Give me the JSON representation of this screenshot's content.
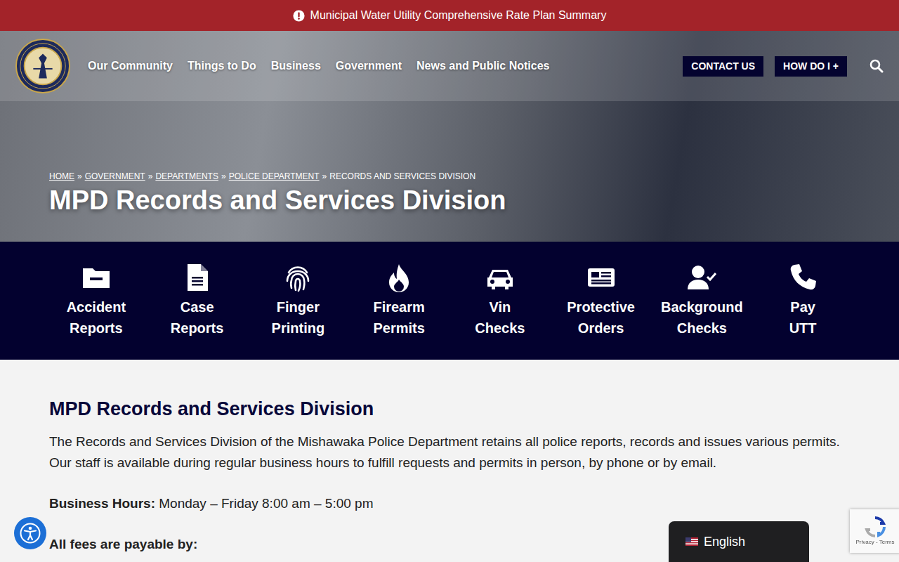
{
  "alert": {
    "text": "Municipal Water Utility Comprehensive Rate Plan Summary"
  },
  "nav": {
    "items": [
      "Our Community",
      "Things to Do",
      "Business",
      "Government",
      "News and Public Notices"
    ],
    "buttons": [
      "CONTACT US",
      "HOW DO I +"
    ]
  },
  "breadcrumb": {
    "separator": "»",
    "items": [
      "HOME",
      "GOVERNMENT",
      "DEPARTMENTS",
      "POLICE DEPARTMENT",
      "RECORDS AND SERVICES DIVISION"
    ]
  },
  "hero": {
    "title": "MPD Records and Services Division"
  },
  "quick_links": [
    {
      "label_lines": [
        "Accident",
        "Reports"
      ]
    },
    {
      "label_lines": [
        "Case",
        "Reports"
      ]
    },
    {
      "label_lines": [
        "Finger",
        "Printing"
      ]
    },
    {
      "label_lines": [
        "Firearm",
        "Permits"
      ]
    },
    {
      "label_lines": [
        "Vin",
        "Checks"
      ]
    },
    {
      "label_lines": [
        "Protective",
        "Orders"
      ]
    },
    {
      "label_lines": [
        "Background",
        "Checks"
      ]
    },
    {
      "label_lines": [
        "Pay",
        "UTT"
      ]
    }
  ],
  "content": {
    "heading": "MPD Records and Services Division",
    "paragraph": "The Records and Services Division of the Mishawaka Police Department retains all police reports, records and issues various permits. Our staff is available during regular business hours to fulfill requests and permits in person, by phone or by email.",
    "hours_label": "Business Hours:",
    "hours_value": "Monday – Friday 8:00 am – 5:00 pm",
    "fees_label": "All fees are payable by:"
  },
  "language": {
    "label": "English"
  },
  "recaptcha": {
    "text": "Privacy - Terms"
  }
}
